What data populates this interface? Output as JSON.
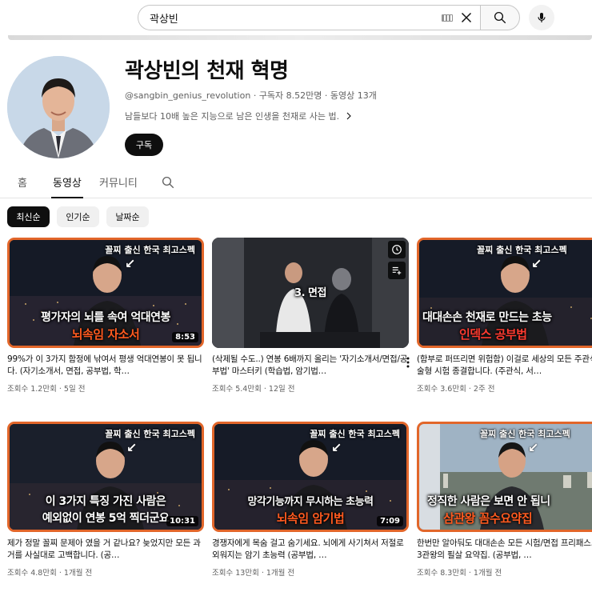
{
  "search": {
    "value": "곽상빈",
    "placeholder": "검색"
  },
  "channel": {
    "name": "곽상빈의 천재 혁명",
    "handle": "@sangbin_genius_revolution",
    "subscribers": "구독자 8.52만명",
    "video_count": "동영상 13개",
    "description": "남들보다 10배 높은 지능으로 남은 인생을 천재로 사는 법.",
    "subscribe_label": "구독"
  },
  "tabs": [
    {
      "label": "홈"
    },
    {
      "label": "동영상"
    },
    {
      "label": "커뮤니티"
    }
  ],
  "chips": [
    {
      "label": "최신순"
    },
    {
      "label": "인기순"
    },
    {
      "label": "날짜순"
    }
  ],
  "videos": [
    {
      "thumb_top": "꼴찌 출신 한국 최고스펙",
      "thumb_mid": "평가자의 뇌를 속여 억대연봉",
      "thumb_bot": "뇌속임 자소서",
      "thumb_bot_color": "#ff5a1f",
      "duration": "8:53",
      "title": "99%가 이 3가지 함정에 낚여서 평생 억대연봉이 못 됩니다. (자기소개서, 면접, 공부법, 학…",
      "views": "조회수 1.2만회",
      "age": "5일 전"
    },
    {
      "thumb_top": "",
      "thumb_mid": "3. 면접",
      "thumb_bot": "",
      "thumb_bot_color": "#ffffff",
      "duration": "",
      "title": "(삭제될 수도..) 연봉 6배까지 올리는 '자기소개서/면접/공부법' 마스터키 (학습법, 암기법…",
      "views": "조회수 5.4만회",
      "age": "12일 전"
    },
    {
      "thumb_top": "꼴찌 출신 한국 최고스펙",
      "thumb_mid": "대대손손 천재로 만드는 초능",
      "thumb_bot": "인덱스 공부법",
      "thumb_bot_color": "#ff3b30",
      "duration": "",
      "title": "(함부로 퍼뜨리면 위험함) 이걸로 세상의 모든 주관식/서술형 시험 종결합니다. (주관식, 서…",
      "views": "조회수 3.6만회",
      "age": "2주 전"
    },
    {
      "thumb_top": "꼴찌 출신 한국 최고스펙",
      "thumb_mid": "이 3가지 특징 가진 사람은",
      "thumb_bot": "예외없이 연봉 5억 찍더군요",
      "thumb_bot_color": "#ffffff",
      "duration": "10:31",
      "title": "제가 정말 꼴찌 문제아 였을 거 같나요? 늦었지만 모든 과거를 사실대로 고백합니다. (공…",
      "views": "조회수 4.8만회",
      "age": "1개월 전"
    },
    {
      "thumb_top": "꼴찌 출신 한국 최고스펙",
      "thumb_mid": "망각기능까지 무시하는 초능력",
      "thumb_bot": "뇌속임 암기법",
      "thumb_bot_color": "#ff5a1f",
      "duration": "7:09",
      "title": "경쟁자에게 목숨 걸고 숨기세요. 뇌에게 사기쳐서 저절로 외워지는 암기 초능력 (공부법, …",
      "views": "조회수 13만회",
      "age": "1개월 전"
    },
    {
      "thumb_top": "꼴찌 출신 한국 최고스펙",
      "thumb_mid": "정직한 사람은 보면 안 됩니",
      "thumb_bot": "삼관왕 꼼수요약집",
      "thumb_bot_color": "#ff5a1f",
      "duration": "",
      "title": "한번만 알아둬도 대대손손 모든 시험/면접 프리패스. 고시 3관왕의 필살 요약집. (공부법, …",
      "views": "조회수 8.3만회",
      "age": "1개월 전"
    }
  ]
}
